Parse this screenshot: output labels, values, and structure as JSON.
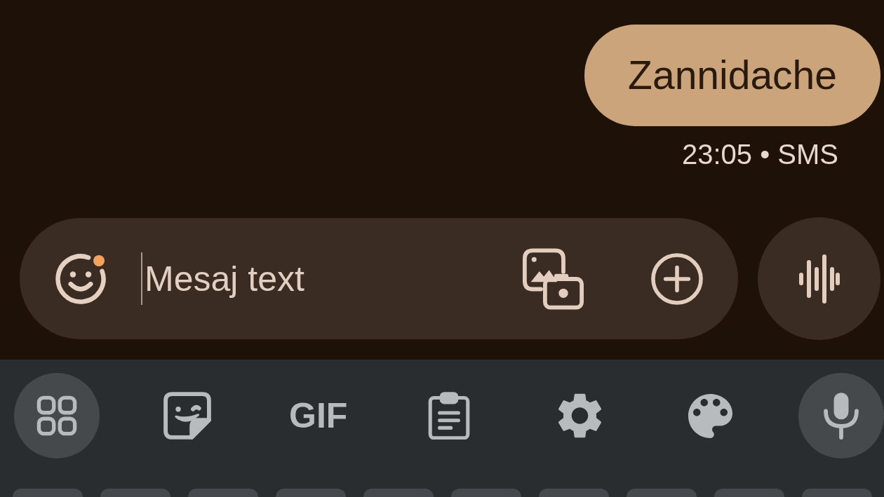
{
  "conversation": {
    "messages": [
      {
        "text": "Zannidache",
        "outgoing": true,
        "meta": "23:05 • SMS"
      }
    ]
  },
  "compose": {
    "placeholder": "Mesaj text",
    "emoji_badge": true
  },
  "keyboard": {
    "toolbar": {
      "gif_label": "GIF"
    }
  }
}
